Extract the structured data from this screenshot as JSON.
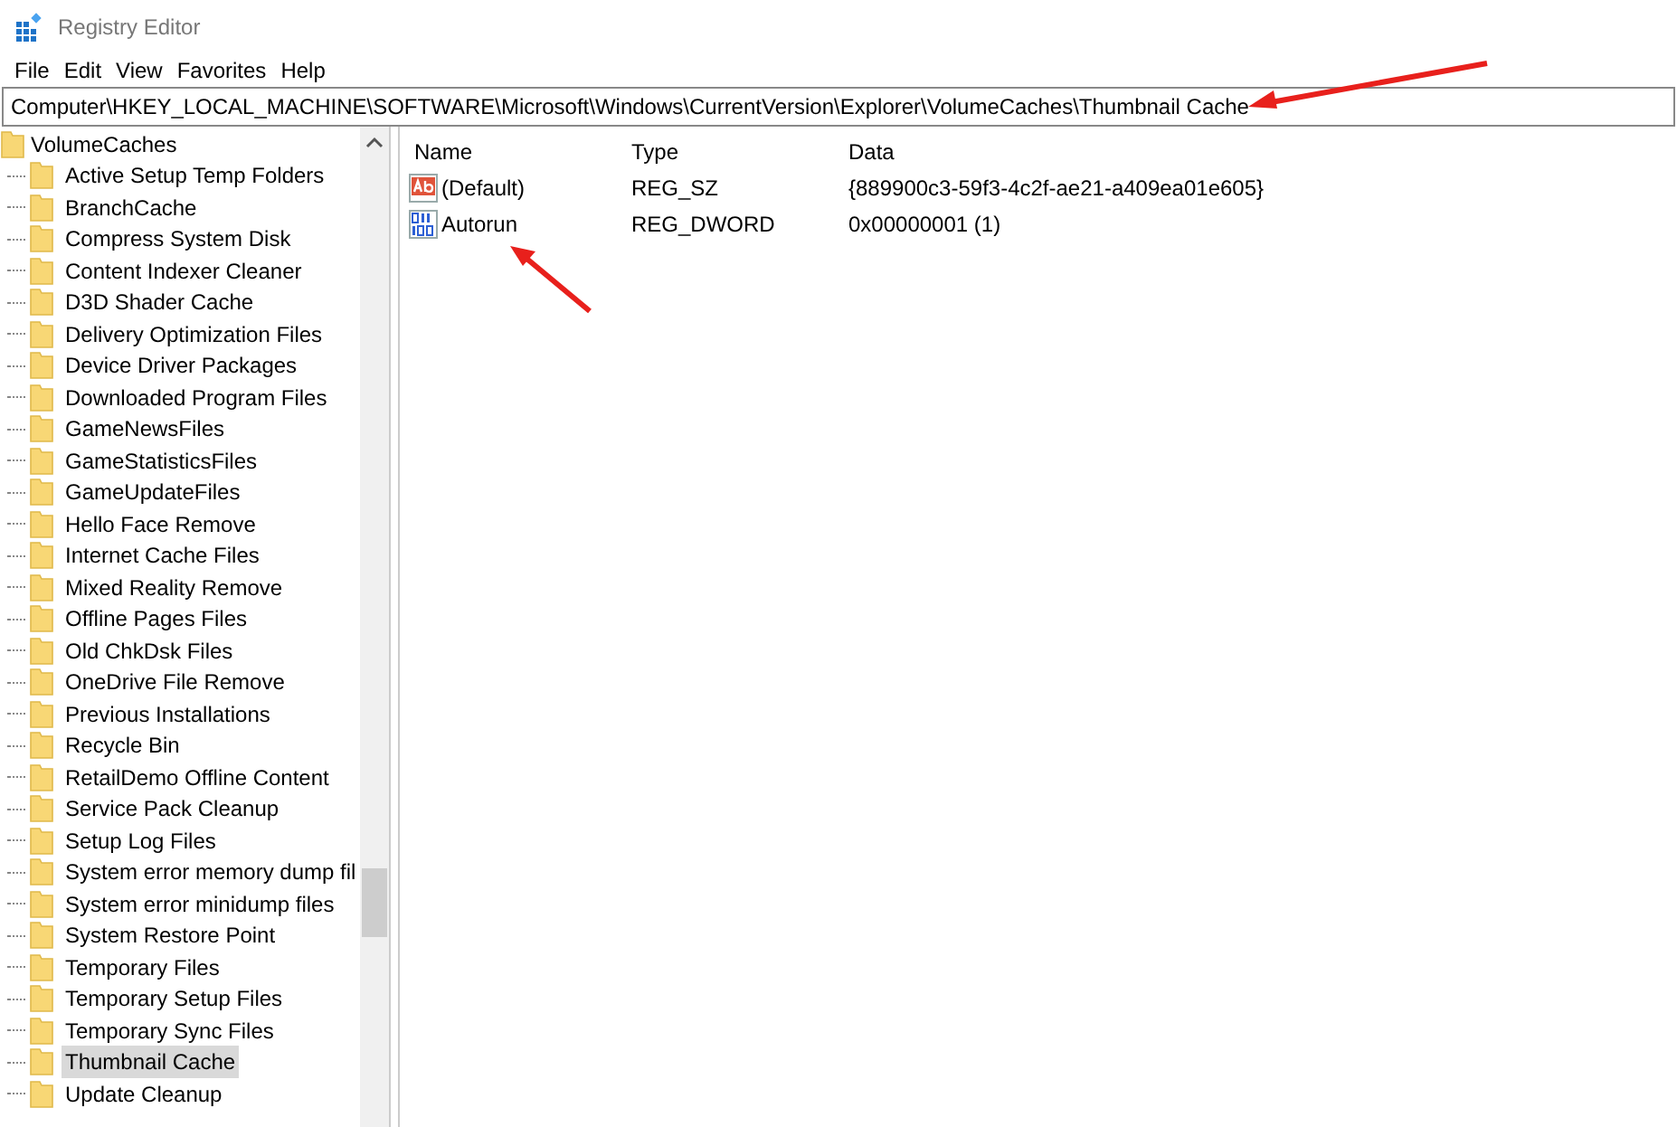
{
  "window": {
    "title": "Registry Editor"
  },
  "menu": [
    "File",
    "Edit",
    "View",
    "Favorites",
    "Help"
  ],
  "address": "Computer\\HKEY_LOCAL_MACHINE\\SOFTWARE\\Microsoft\\Windows\\CurrentVersion\\Explorer\\VolumeCaches\\Thumbnail Cache",
  "tree": {
    "label": "VolumeCaches",
    "children": [
      {
        "label": "Active Setup Temp Folders",
        "selected": false
      },
      {
        "label": "BranchCache",
        "selected": false
      },
      {
        "label": "Compress System Disk",
        "selected": false
      },
      {
        "label": "Content Indexer Cleaner",
        "selected": false
      },
      {
        "label": "D3D Shader Cache",
        "selected": false
      },
      {
        "label": "Delivery Optimization Files",
        "selected": false
      },
      {
        "label": "Device Driver Packages",
        "selected": false
      },
      {
        "label": "Downloaded Program Files",
        "selected": false
      },
      {
        "label": "GameNewsFiles",
        "selected": false
      },
      {
        "label": "GameStatisticsFiles",
        "selected": false
      },
      {
        "label": "GameUpdateFiles",
        "selected": false
      },
      {
        "label": "Hello Face Remove",
        "selected": false
      },
      {
        "label": "Internet Cache Files",
        "selected": false
      },
      {
        "label": "Mixed Reality Remove",
        "selected": false
      },
      {
        "label": "Offline Pages Files",
        "selected": false
      },
      {
        "label": "Old ChkDsk Files",
        "selected": false
      },
      {
        "label": "OneDrive File Remove",
        "selected": false
      },
      {
        "label": "Previous Installations",
        "selected": false
      },
      {
        "label": "Recycle Bin",
        "selected": false
      },
      {
        "label": "RetailDemo Offline Content",
        "selected": false
      },
      {
        "label": "Service Pack Cleanup",
        "selected": false
      },
      {
        "label": "Setup Log Files",
        "selected": false
      },
      {
        "label": "System error memory dump fil",
        "selected": false
      },
      {
        "label": "System error minidump files",
        "selected": false
      },
      {
        "label": "System Restore Point",
        "selected": false
      },
      {
        "label": "Temporary Files",
        "selected": false
      },
      {
        "label": "Temporary Setup Files",
        "selected": false
      },
      {
        "label": "Temporary Sync Files",
        "selected": false
      },
      {
        "label": "Thumbnail Cache",
        "selected": true
      },
      {
        "label": "Update Cleanup",
        "selected": false
      }
    ]
  },
  "values": {
    "columns": [
      "Name",
      "Type",
      "Data"
    ],
    "rows": [
      {
        "kind": "string",
        "name": "(Default)",
        "type": "REG_SZ",
        "data": "{889900c3-59f3-4c2f-ae21-a409ea01e605}"
      },
      {
        "kind": "binary",
        "name": "Autorun",
        "type": "REG_DWORD",
        "data": "0x00000001 (1)"
      }
    ]
  }
}
